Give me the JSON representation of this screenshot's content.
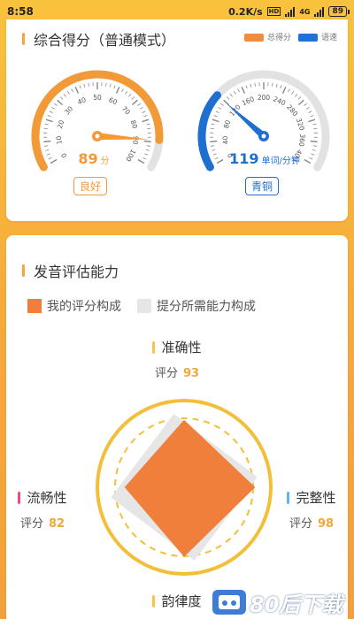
{
  "status": {
    "time": "8:58",
    "speed": "0.2K/s",
    "network": "4G",
    "battery": "89"
  },
  "overall": {
    "title": "综合得分（普通模式）",
    "legend": [
      {
        "label": "总得分",
        "color": "#f08c3c"
      },
      {
        "label": "语速",
        "color": "#1f73d8"
      }
    ],
    "score_gauge": {
      "value": 89,
      "unit": "分",
      "badge": "良好",
      "color": "#f29a38",
      "max": 100,
      "ticks": [
        "0",
        "10",
        "20",
        "30",
        "40",
        "50",
        "60",
        "70",
        "80",
        "90",
        "100"
      ]
    },
    "speed_gauge": {
      "value": 119,
      "unit": "单词/分钟",
      "badge": "青铜",
      "color": "#1f6fd3",
      "max": 400,
      "ticks": [
        "0",
        "40",
        "80",
        "120",
        "160",
        "200",
        "240",
        "280",
        "320",
        "360",
        "400"
      ]
    }
  },
  "pronunciation": {
    "title": "发音评估能力",
    "legend": [
      {
        "label": "我的评分构成",
        "color": "#f07f3c"
      },
      {
        "label": "提分所需能力构成",
        "color": "#e6e6e6"
      }
    ],
    "axes": [
      {
        "name": "准确性",
        "score_label": "评分",
        "score": "93",
        "marker_color": "#f3c64a"
      },
      {
        "name": "完整性",
        "score_label": "评分",
        "score": "98",
        "marker_color": "#5ab8e6"
      },
      {
        "name": "韵律度",
        "score_label": "评分",
        "score": "",
        "marker_color": "#f3c64a"
      },
      {
        "name": "流畅性",
        "score_label": "评分",
        "score": "82",
        "marker_color": "#e84a8a"
      }
    ],
    "values": [
      93,
      98,
      96,
      82
    ],
    "target_values": [
      100,
      100,
      100,
      100
    ]
  },
  "watermark": {
    "text": "80后下载"
  }
}
